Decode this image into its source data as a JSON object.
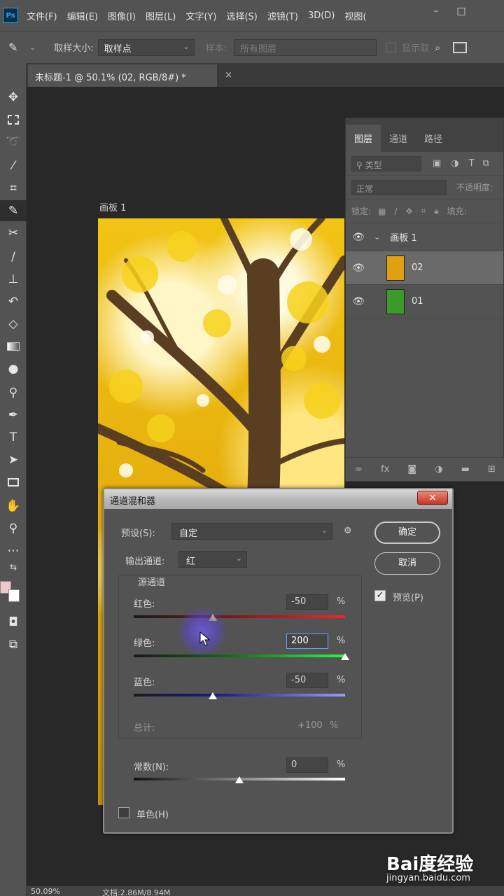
{
  "app": {
    "logo": "Ps",
    "menus": [
      "文件(F)",
      "编辑(E)",
      "图像(I)",
      "图层(L)",
      "文字(Y)",
      "选择(S)",
      "滤镜(T)",
      "3D(D)",
      "视图("
    ],
    "window_controls": [
      "–",
      "□"
    ]
  },
  "options_bar": {
    "sample_size_label": "取样大小:",
    "sample_size_value": "取样点",
    "sample_label": "样本:",
    "sample_value": "所有图层",
    "show_ring_label": "显示取"
  },
  "document_tab": {
    "title": "未标题-1 @ 50.1% (02, RGB/8#) *",
    "close": "×"
  },
  "artboard": {
    "label": "画板 1"
  },
  "tools": [
    "move-tool",
    "marquee-tool",
    "lasso-tool",
    "magic-wand-tool",
    "crop-tool",
    "eyedropper-tool",
    "healing-tool",
    "brush-tool",
    "stamp-tool",
    "history-brush-tool",
    "eraser-tool",
    "gradient-tool",
    "blur-tool",
    "dodge-tool",
    "pen-tool",
    "type-tool",
    "path-select-tool",
    "rectangle-tool",
    "hand-tool",
    "zoom-tool",
    "more-tools",
    "quick-mask-tool",
    "screen-mode-tool"
  ],
  "colors": {
    "foreground": "#f0c6cb",
    "background": "#ffffff",
    "accent": "#2fa3f7"
  },
  "layers_panel": {
    "tabs": [
      "图层",
      "通道",
      "路径"
    ],
    "filter_placeholder": "类型",
    "blend_mode": "正常",
    "opacity_label": "不透明度:",
    "lock_label": "锁定:",
    "fill_label": "填充:",
    "group_name": "画板 1",
    "layers": [
      {
        "name": "02",
        "selected": true,
        "thumb_color": "#e0a010"
      },
      {
        "name": "01",
        "selected": false,
        "thumb_color": "#3a9a2a"
      }
    ],
    "footer_icons": [
      "link-icon",
      "fx-icon",
      "mask-icon",
      "adjustment-icon",
      "folder-icon",
      "new-layer-icon"
    ]
  },
  "dialog": {
    "title": "通道混和器",
    "close": "×",
    "preset_label": "预设(S):",
    "preset_value": "自定",
    "output_label": "输出通道:",
    "output_value": "红",
    "source_group_label": "源通道",
    "red_label": "红色:",
    "red_value": "-50",
    "green_label": "绿色:",
    "green_value": "200",
    "blue_label": "蓝色:",
    "blue_value": "-50",
    "percent": "%",
    "total_label": "总计:",
    "total_value": "+100",
    "constant_label": "常数(N):",
    "constant_value": "0",
    "monochrome_label": "单色(H)",
    "ok_label": "确定",
    "cancel_label": "取消",
    "preview_label": "预览(P)",
    "preview_checked": true,
    "monochrome_checked": false,
    "slider_range": [
      -200,
      200
    ],
    "red_level": -50,
    "green_level": 200,
    "blue_level": -50,
    "constant_level": 0
  },
  "status_bar": {
    "zoom": "50.09%",
    "doc_info": "文档:2.86M/8.94M"
  },
  "watermark": {
    "logo": "Bai度经验",
    "url": "jingyan.baidu.com"
  }
}
